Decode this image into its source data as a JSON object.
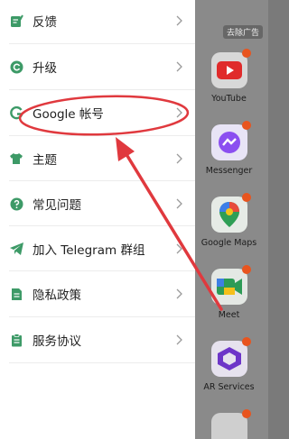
{
  "menu": {
    "items": [
      {
        "label": "反馈"
      },
      {
        "label": "升级"
      },
      {
        "label": "Google 帐号"
      },
      {
        "label": "主题"
      },
      {
        "label": "常见问题"
      },
      {
        "label": "加入 Telegram 群组"
      },
      {
        "label": "隐私政策"
      },
      {
        "label": "服务协议"
      }
    ]
  },
  "background": {
    "ad_tag": "去除广告",
    "apps": [
      {
        "label": "YouTube",
        "icon": "youtube-icon"
      },
      {
        "label": "Messenger",
        "icon": "messenger-icon"
      },
      {
        "label": "Google Maps",
        "icon": "maps-icon"
      },
      {
        "label": "Meet",
        "icon": "meet-icon"
      },
      {
        "label": "AR Services",
        "icon": "ar-services-icon"
      },
      {
        "label": "",
        "icon": "app-icon"
      }
    ]
  },
  "colors": {
    "accent_green": "#3d9a67",
    "annotation_red": "#e0393e",
    "drawer_bg": "#ffffff"
  }
}
